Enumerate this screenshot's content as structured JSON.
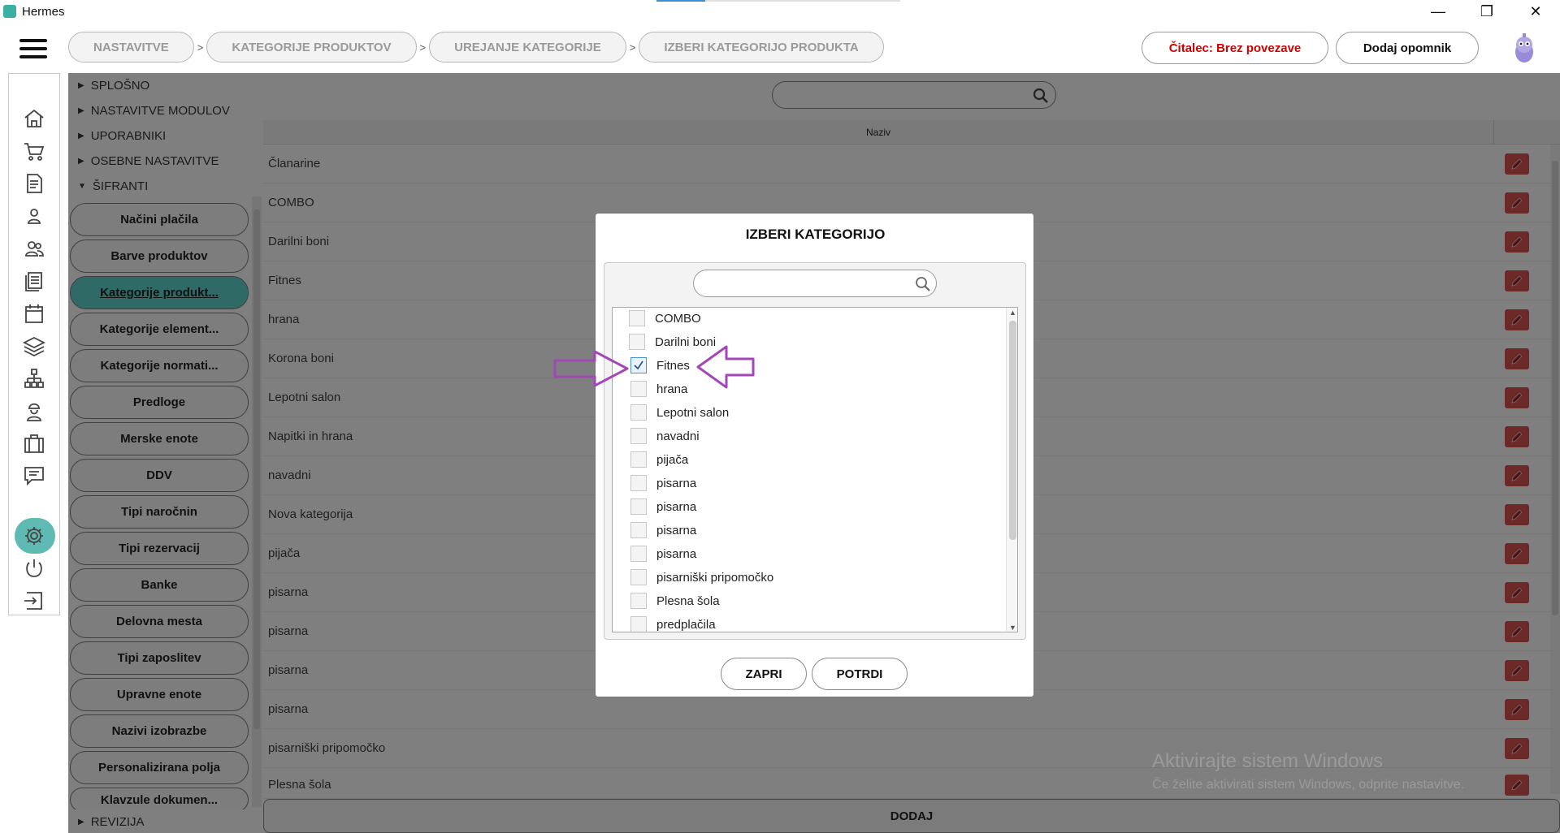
{
  "window": {
    "title": "Hermes",
    "controls": {
      "minimize": "—",
      "maximize": "❐",
      "close": "✕"
    }
  },
  "topbar": {
    "breadcrumbs": [
      "NASTAVITVE",
      "KATEGORIJE PRODUKTOV",
      "UREJANJE KATEGORIJE",
      "IZBERI KATEGORIJO PRODUKTA"
    ],
    "separator": ">",
    "reader_label": "Čitalec: Brez povezave",
    "reminder_label": "Dodaj opomnik"
  },
  "sidebar_icons": [
    "home-icon",
    "cart-icon",
    "document-icon",
    "person-icon",
    "people-icon",
    "list-icon",
    "calendar-icon",
    "layers-icon",
    "hierarchy-icon",
    "worker-icon",
    "briefcase-icon",
    "chat-icon",
    "gear-icon",
    "power-icon",
    "logout-icon"
  ],
  "tree": {
    "sections": [
      "SPLOŠNO",
      "NASTAVITVE MODULOV",
      "UPORABNIKI",
      "OSEBNE NASTAVITVE",
      "ŠIFRANTI"
    ],
    "items": [
      "Načini plačila",
      "Barve produktov",
      "Kategorije produkt...",
      "Kategorije element...",
      "Kategorije normati...",
      "Predloge",
      "Merske enote",
      "DDV",
      "Tipi naročnin",
      "Tipi rezervacij",
      "Banke",
      "Delovna mesta",
      "Tipi zaposlitev",
      "Upravne enote",
      "Nazivi izobrazbe",
      "Personalizirana polja",
      "Klavzule dokumen..."
    ],
    "active_index": 2,
    "bottom_section": "REVIZIJA"
  },
  "main": {
    "column_header": "Naziv",
    "rows": [
      "Članarine",
      "COMBO",
      "Darilni boni",
      "Fitnes",
      "hrana",
      "Korona boni",
      "Lepotni salon",
      "Napitki in hrana",
      "navadni",
      "Nova kategorija",
      "pijača",
      "pisarna",
      "pisarna",
      "pisarna",
      "pisarna",
      "pisarniški pripomočko",
      "Plesna šola"
    ],
    "add_label": "DODAJ"
  },
  "modal": {
    "title": "IZBERI KATEGORIJO",
    "search_placeholder": "",
    "items": [
      {
        "label": "COMBO",
        "checked": false
      },
      {
        "label": "Darilni boni",
        "checked": false
      },
      {
        "label": "Fitnes",
        "checked": true
      },
      {
        "label": "hrana",
        "checked": false
      },
      {
        "label": "Lepotni salon",
        "checked": false
      },
      {
        "label": "navadni",
        "checked": false
      },
      {
        "label": "pijača",
        "checked": false
      },
      {
        "label": "pisarna",
        "checked": false
      },
      {
        "label": "pisarna",
        "checked": false
      },
      {
        "label": "pisarna",
        "checked": false
      },
      {
        "label": "pisarna",
        "checked": false
      },
      {
        "label": "pisarniški pripomočko",
        "checked": false
      },
      {
        "label": "Plesna šola",
        "checked": false
      },
      {
        "label": "predplačila",
        "checked": false
      }
    ],
    "close_label": "ZAPRI",
    "confirm_label": "POTRDI"
  },
  "watermark": {
    "line1": "Aktivirajte sistem Windows",
    "line2": "Če želite aktivirati sistem Windows, odprite nastavitve."
  },
  "colors": {
    "accent": "#5fbab3",
    "active_item": "#2f6a66",
    "alert": "#d10000",
    "annotation": "#a347b8",
    "edit_button": "#6b2a28"
  }
}
